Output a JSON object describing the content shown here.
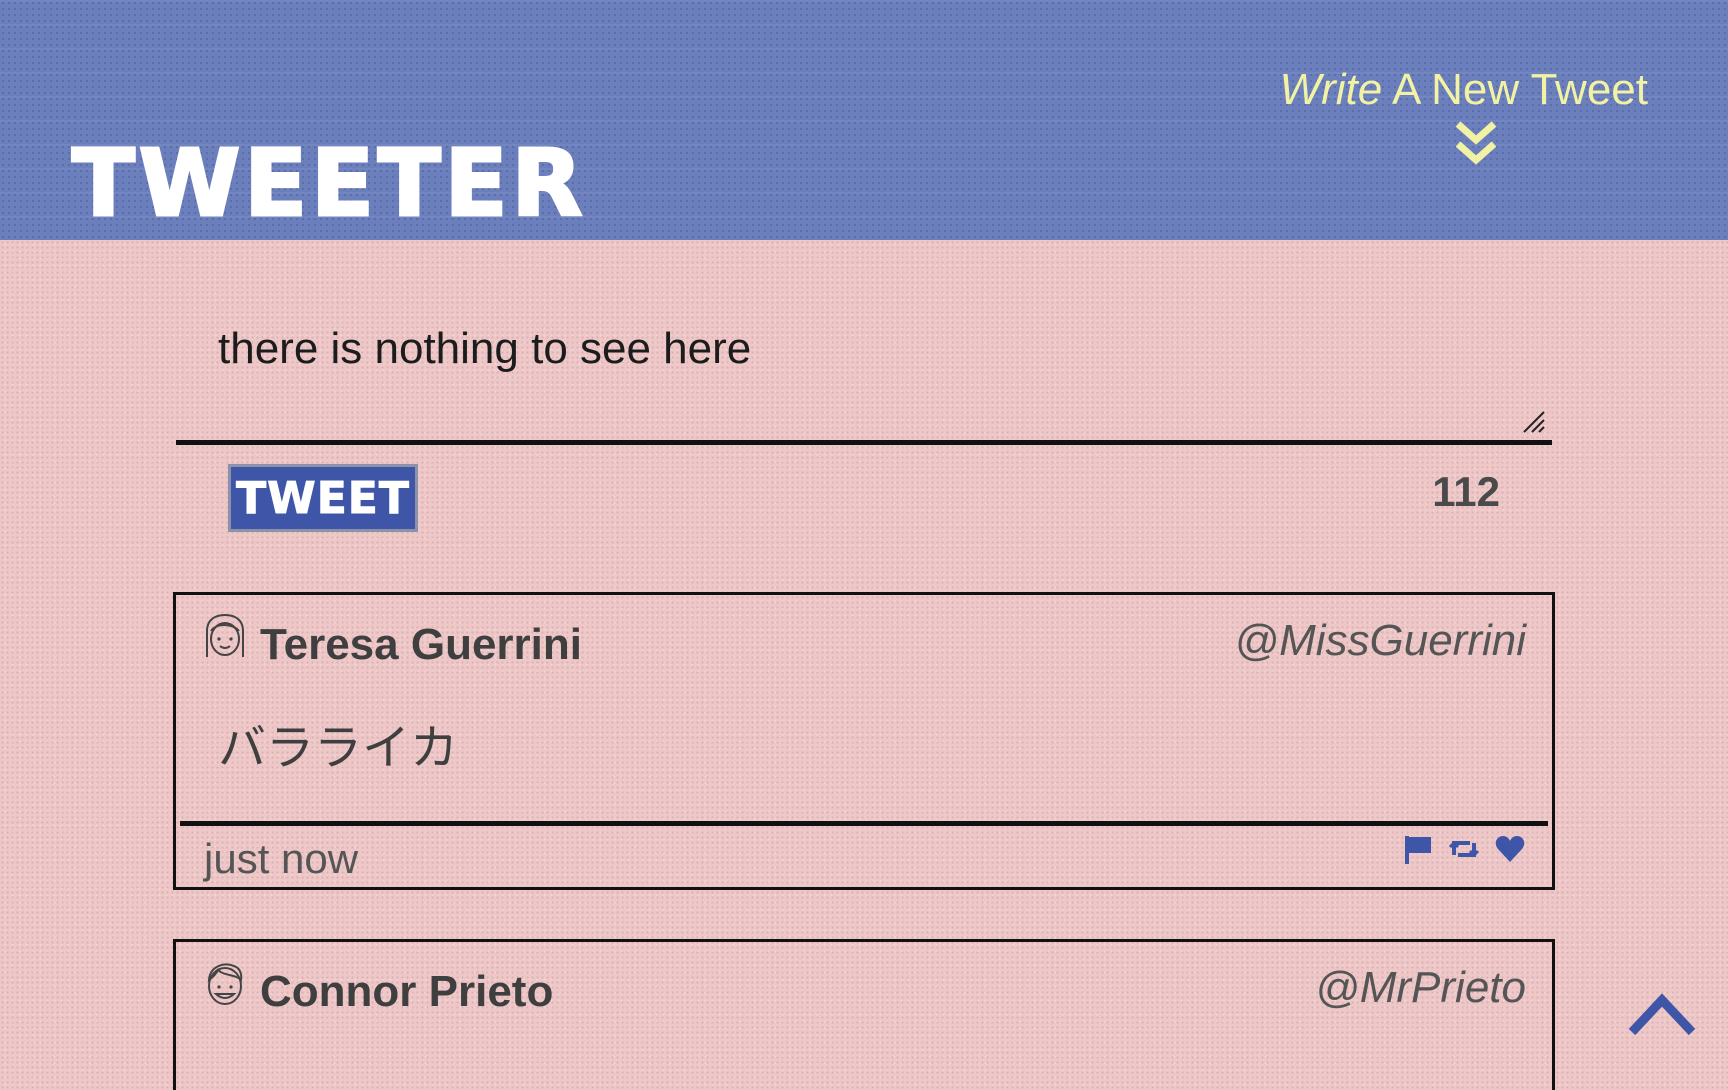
{
  "header": {
    "brand": "Tweeter",
    "compose_toggle": {
      "prefix": "Write",
      "rest": " A New Tweet",
      "icon": "double-chevron-down-icon"
    }
  },
  "compose": {
    "text": "there is nothing to see here",
    "tweet_button": "Tweet",
    "char_counter": "112"
  },
  "tweets": [
    {
      "avatar_icon": "girl-avatar-icon",
      "name": "Teresa Guerrini",
      "handle": "@MissGuerrini",
      "content": "バラライカ",
      "time": "just now",
      "actions": [
        "flag-icon",
        "retweet-icon",
        "heart-icon"
      ]
    },
    {
      "avatar_icon": "boy-avatar-icon",
      "name": "Connor Prieto",
      "handle": "@MrPrieto",
      "content": "",
      "time": "",
      "actions": []
    }
  ],
  "colors": {
    "header_bg": "#6b7fbc",
    "page_bg": "#efc7c7",
    "accent_blue": "#3f55a7",
    "toggle_yellow": "#f1f2a4"
  },
  "scroll_top_icon": "chevron-up-icon"
}
